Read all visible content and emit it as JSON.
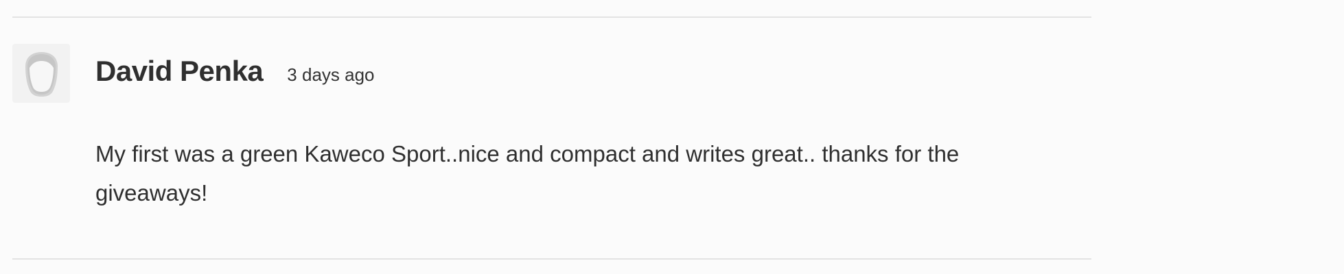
{
  "comment": {
    "author": "David Penka",
    "timestamp": "3 days ago",
    "body": "My first was a green Kaweco Sport..nice and compact and writes great.. thanks for the giveaways!",
    "avatar_icon": "default-user-avatar-icon"
  },
  "colors": {
    "background": "#fbfbfb",
    "divider": "#e3e3e3",
    "text": "#2f2f2f",
    "avatar_bg": "#f2f2f2",
    "avatar_silhouette": "#c9c9c9"
  }
}
